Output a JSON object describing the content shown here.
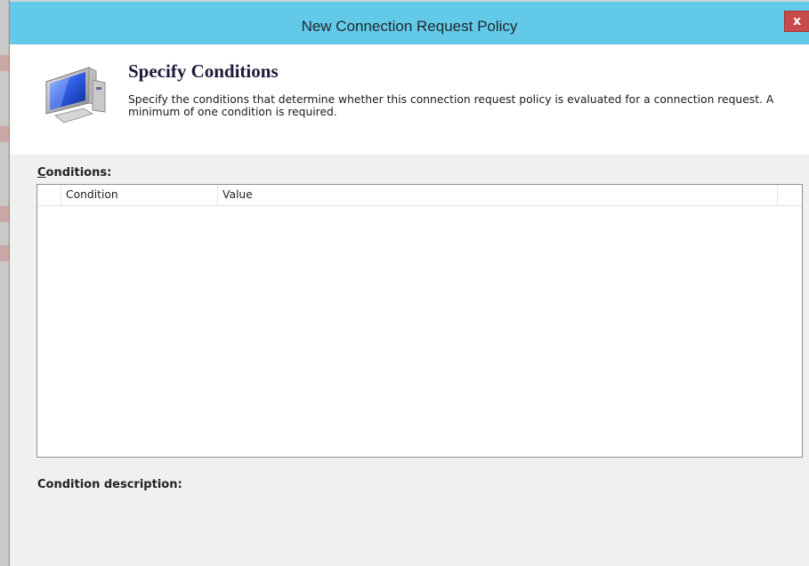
{
  "window": {
    "title": "New Connection Request Policy",
    "close_glyph": "x"
  },
  "header": {
    "heading": "Specify Conditions",
    "description_line1": "Specify the conditions that determine whether this connection request policy is evaluated for a connection request. A",
    "description_line2": "minimum of one condition is required.",
    "icon": "monitor-icon"
  },
  "conditions": {
    "label_access_key": "C",
    "label_rest": "onditions:",
    "columns": [
      "",
      "Condition",
      "Value",
      ""
    ],
    "rows": []
  },
  "description": {
    "label": "Condition description:",
    "text": ""
  },
  "colors": {
    "titlebar": "#62cae8",
    "close_button": "#c84b4b",
    "dialog_background": "#f0f0f0"
  }
}
